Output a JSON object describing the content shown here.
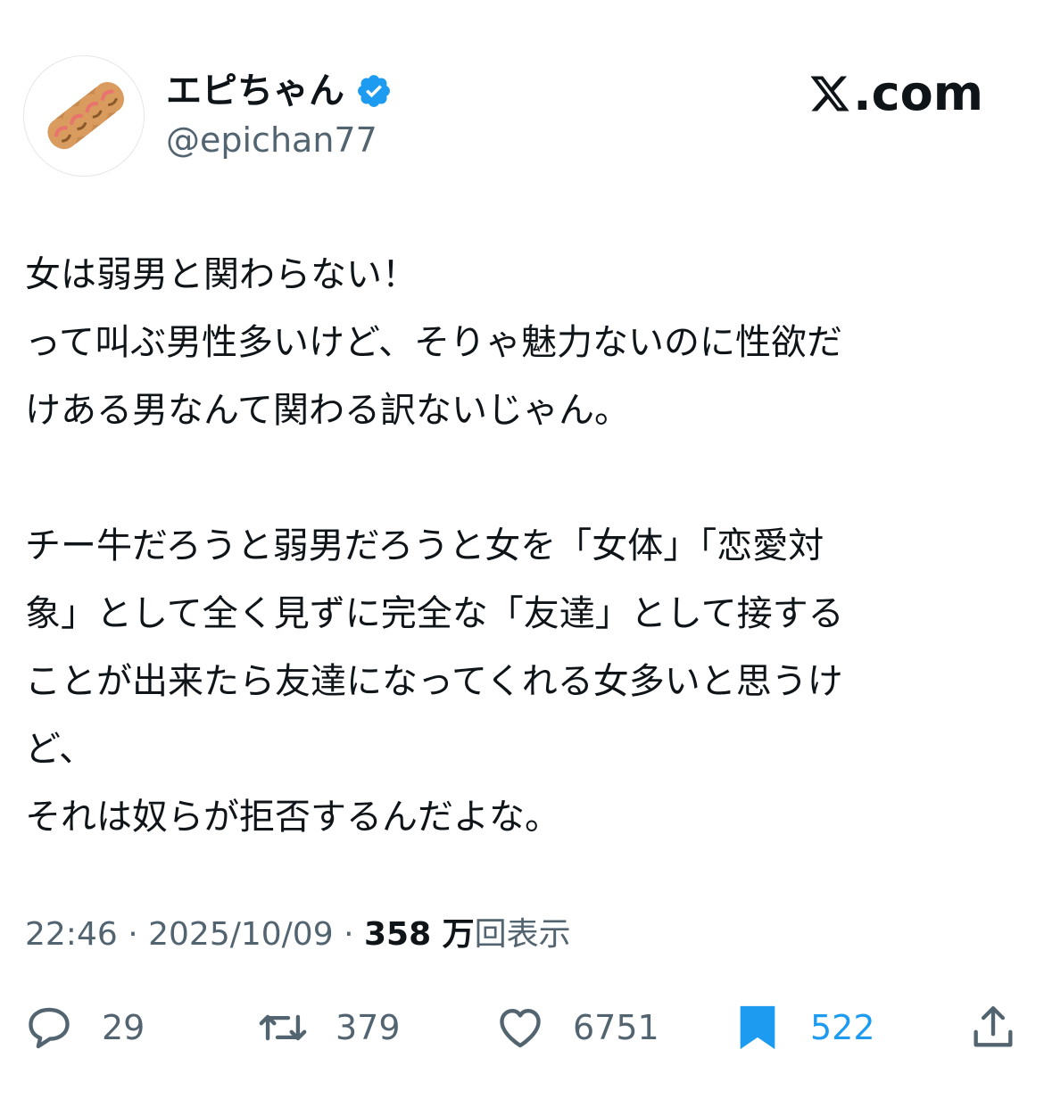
{
  "user": {
    "display_name": "エピちゃん",
    "handle": "@epichan77",
    "verified": true,
    "avatar_icon": "churro-pastry-icon"
  },
  "brand": {
    "label": ".com",
    "logo_icon": "x-logo-icon"
  },
  "tweet": {
    "lines": [
      "女は弱男と関わらない！",
      "って叫ぶ男性多いけど、そりゃ魅力ないのに性欲だ",
      "けある男なんて関わる訳ないじゃん。",
      "",
      "チー牛だろうと弱男だろうと女を「女体」「恋愛対",
      "象」として全く見ずに完全な「友達」として接する",
      "ことが出来たら友達になってくれる女多いと思うけ",
      "ど、",
      "それは奴らが拒否するんだよな。"
    ]
  },
  "meta": {
    "time": "22:46",
    "separator": "·",
    "date": "2025/10/09",
    "views_count": "358 万",
    "views_label": "回表示"
  },
  "actions": {
    "replies": "29",
    "retweets": "379",
    "likes": "6751",
    "bookmarks": "522"
  },
  "colors": {
    "accent": "#1d9bf0",
    "text": "#0f1419",
    "secondary": "#536471"
  }
}
